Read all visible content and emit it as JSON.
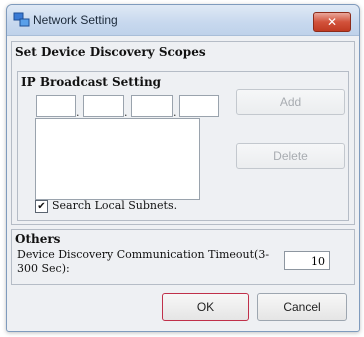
{
  "window": {
    "title": "Network Setting",
    "close_label": "✕"
  },
  "scopes": {
    "group_title": "Set Device Discovery Scopes",
    "ip_broadcast_title": "IP Broadcast Setting",
    "add_label": "Add",
    "delete_label": "Delete",
    "search_local_label": "Search Local Subnets.",
    "search_local_checked": true,
    "checkbox_mark": "✔"
  },
  "others": {
    "group_title": "Others",
    "timeout_label": "Device Discovery Communication Timeout(3-300 Sec):",
    "timeout_value": "10"
  },
  "buttons": {
    "ok_label": "OK",
    "cancel_label": "Cancel"
  },
  "colors": {
    "close_red": "#d2523b",
    "ok_border": "#c0304a",
    "title_blue": "#c7d8ee"
  }
}
